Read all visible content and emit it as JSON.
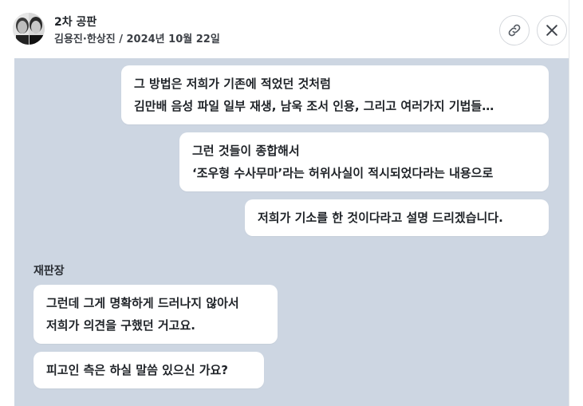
{
  "header": {
    "title": "2차 공판",
    "subtitle": "김용진·한상진 / 2024년 10월 22일"
  },
  "messages": [
    {
      "side": "right",
      "lines": [
        "그 방법은 저희가 기존에 적었던 것처럼",
        "김만배 음성 파일 일부 재생, 남욱 조서 인용, 그리고 여러가지 기법들…"
      ]
    },
    {
      "side": "right",
      "lines": [
        "그런 것들이 종합해서",
        "‘조우형 수사무마’라는 허위사실이 적시되었다라는 내용으로"
      ]
    },
    {
      "side": "right",
      "lines": [
        "저희가 기소를 한 것이다라고 설명 드리겠습니다."
      ]
    },
    {
      "side": "left",
      "speaker": "재판장",
      "lines": [
        "그런데 그게 명확하게 드러나지 않아서",
        "저희가 의견을 구했던 거고요."
      ]
    },
    {
      "side": "left",
      "lines": [
        "피고인 측은 하실 말씀 있으신 가요?"
      ]
    }
  ]
}
